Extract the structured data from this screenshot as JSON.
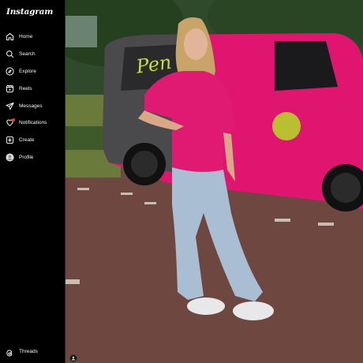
{
  "app": {
    "logo_text": "Instagram"
  },
  "nav": {
    "items": [
      {
        "label": "Home",
        "icon": "home-icon"
      },
      {
        "label": "Search",
        "icon": "search-icon"
      },
      {
        "label": "Explore",
        "icon": "explore-icon"
      },
      {
        "label": "Reels",
        "icon": "reels-icon"
      },
      {
        "label": "Messages",
        "icon": "messages-icon"
      },
      {
        "label": "Notifications",
        "icon": "notifications-icon"
      },
      {
        "label": "Create",
        "icon": "create-icon"
      },
      {
        "label": "Profile",
        "icon": "profile-avatar"
      }
    ],
    "threads_label": "Threads"
  },
  "colors": {
    "sidebar_bg": "#000000",
    "text": "#f5f5f5",
    "notification_dot": "#ff3040",
    "van_pink": "#e0156f",
    "shirt_pink": "#e01a72",
    "jeans": "#a9bdd3"
  }
}
